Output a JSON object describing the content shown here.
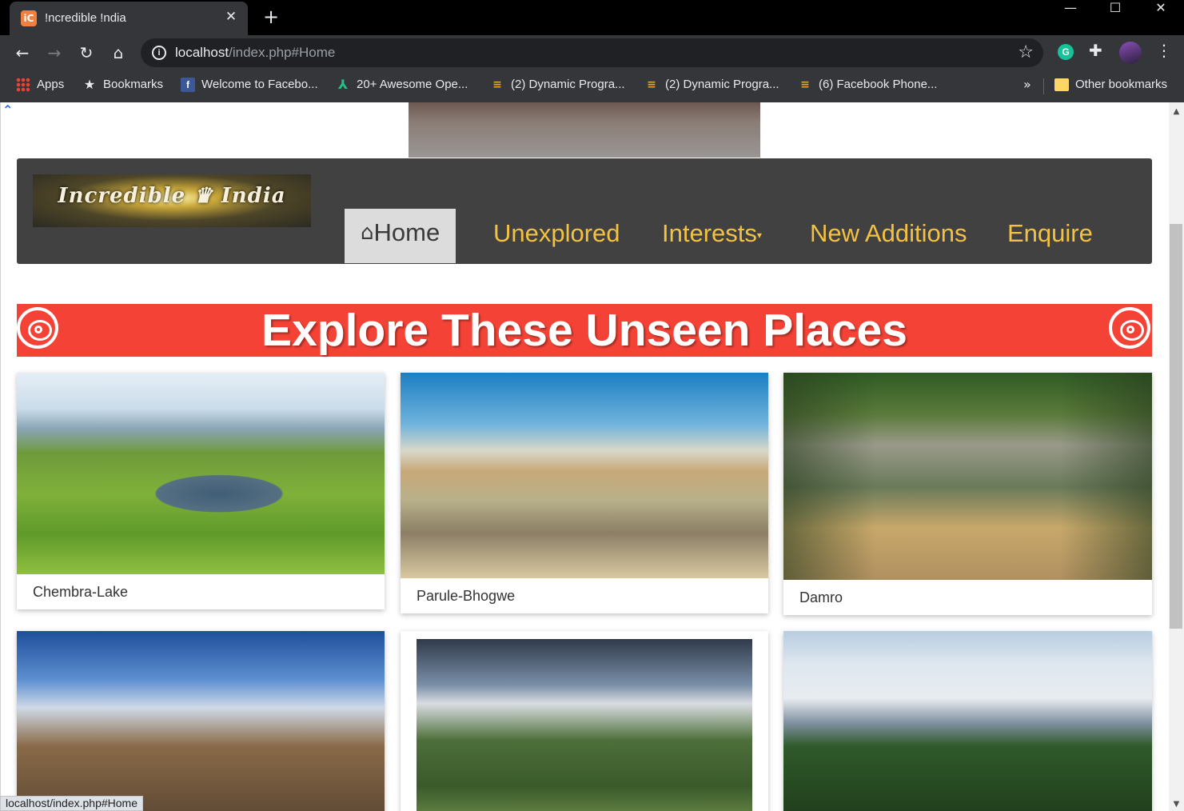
{
  "browser": {
    "tab_title": "!ncredible !ndia",
    "tab_favicon": "iC",
    "tab_close": "✕",
    "new_tab": "+",
    "window_controls": {
      "minimize": "—",
      "maximize": "☐",
      "close": "✕"
    },
    "nav": {
      "back": "←",
      "forward": "→",
      "reload": "↻",
      "home": "⌂"
    },
    "url_host": "localhost",
    "url_path": "/index.php#Home",
    "bookmark_star": "☆",
    "extension_grammarly": "G",
    "extension_puzzle": "✚",
    "menu": "⋮",
    "bookmarks": [
      {
        "label": "Apps",
        "icon": "apps-grid-icon"
      },
      {
        "label": "Bookmarks",
        "icon": "star-icon",
        "glyph": "★"
      },
      {
        "label": "Welcome to Facebo...",
        "icon": "facebook-icon",
        "glyph": "f"
      },
      {
        "label": "20+ Awesome Ope...",
        "icon": "a-logo-icon",
        "glyph": "⅄"
      },
      {
        "label": "(2) Dynamic Progra...",
        "icon": "stackoverflow-icon",
        "glyph": "≡"
      },
      {
        "label": "(2) Dynamic Progra...",
        "icon": "stackoverflow-icon",
        "glyph": "≡"
      },
      {
        "label": "(6) Facebook Phone...",
        "icon": "stackoverflow-icon",
        "glyph": "≡"
      }
    ],
    "bookmarks_more": "»",
    "other_bookmarks": "Other bookmarks",
    "status_url": "localhost/index.php#Home"
  },
  "page": {
    "scroll_top_glyph": "⌃",
    "logo_text": "Incredible ♛ India",
    "nav": {
      "home_icon": "⌂",
      "home": "Home",
      "unexplored": "Unexplored",
      "interests": "Interests",
      "interests_caret": "▾",
      "new_additions": "New Additions",
      "enquire": "Enquire"
    },
    "banner_title": "Explore These Unseen Places",
    "places": [
      {
        "name": "Chembra-Lake"
      },
      {
        "name": "Parule-Bhogwe"
      },
      {
        "name": "Damro"
      },
      {
        "name": ""
      },
      {
        "name": ""
      },
      {
        "name": ""
      }
    ]
  },
  "colors": {
    "navbar_bg": "#414141",
    "nav_link": "#f4c242",
    "banner_bg": "#f44336",
    "chrome_dark": "#35363a"
  }
}
